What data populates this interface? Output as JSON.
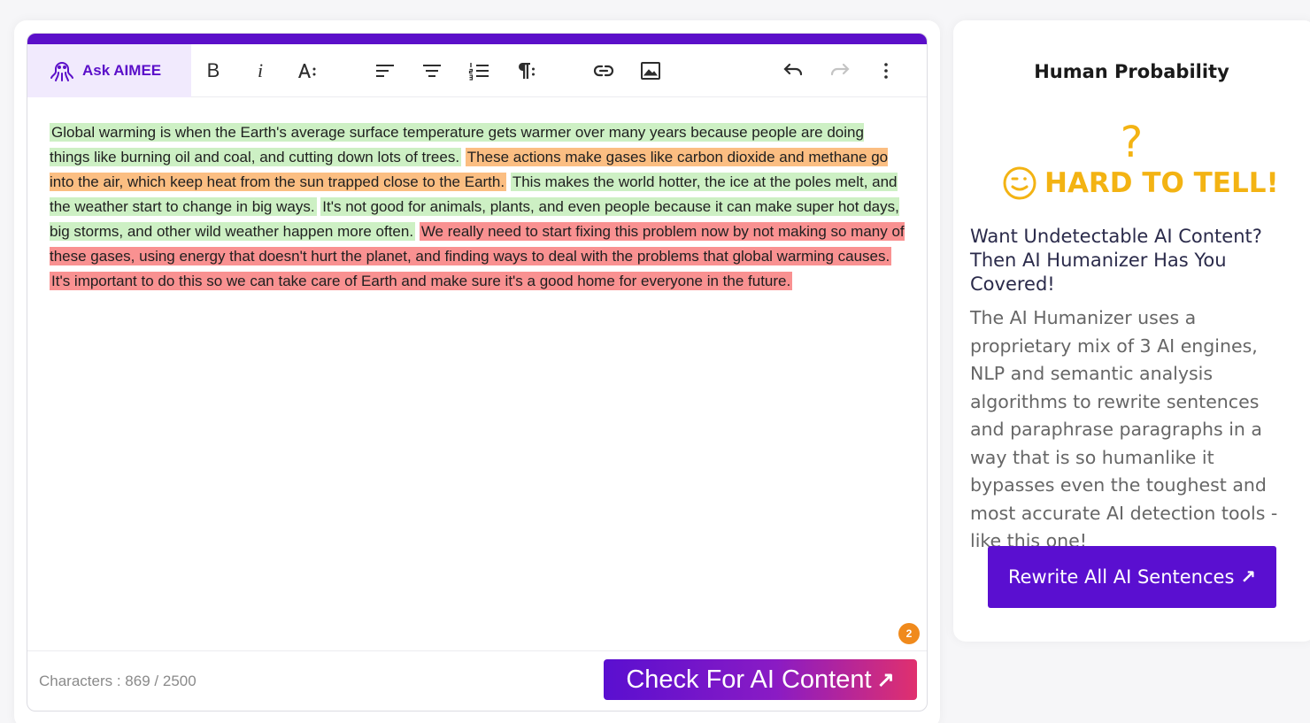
{
  "editor": {
    "ask_label": "Ask AIMEE",
    "toolbar_icons": [
      "bold-icon",
      "italic-icon",
      "font-size-icon",
      "align-left-icon",
      "align-center-icon",
      "numbered-list-icon",
      "paragraph-icon",
      "link-icon",
      "image-icon",
      "undo-icon",
      "redo-icon",
      "more-icon"
    ],
    "sentences": [
      {
        "text": "Global warming is when the Earth's average surface temperature gets warmer over many years because people are doing things like burning oil and coal, and cutting down lots of trees.",
        "status": "green"
      },
      {
        "text": "These actions make gases like carbon dioxide and methane go into the air, which keep heat from the sun trapped close to the Earth.",
        "status": "orange"
      },
      {
        "text": "This makes the world hotter, the ice at the poles melt, and the weather start to change in big ways.",
        "status": "green"
      },
      {
        "text": "It's not good for animals, plants, and even people because it can make super hot days, big storms, and other wild weather happen more often.",
        "status": "green"
      },
      {
        "text": "We really need to start fixing this problem now by not making so many of these gases, using energy that doesn't hurt the planet, and finding ways to deal with the problems that global warming causes.",
        "status": "red"
      },
      {
        "text": "It's important to do this so we can take care of Earth and make sure it's a good home for everyone in the future.",
        "status": "red"
      }
    ],
    "badge_count": "2",
    "characters_label": "Characters : 869",
    "characters_limit": "/ 2500",
    "check_button": "Check For AI Content",
    "colors": {
      "accent": "#5b0fc9",
      "green": "#cdf0c4",
      "orange": "#fbbe82",
      "red": "#f99191"
    }
  },
  "side": {
    "title": "Human Probability",
    "question_mark": "?",
    "verdict": "HARD TO TELL!",
    "verdict_color": "#f3b313",
    "promo_heading": "Want Undetectable AI Content? Then AI Humanizer Has You Covered!",
    "promo_body": "The AI Humanizer uses a proprietary mix of 3 AI engines, NLP and semantic analysis algorithms to rewrite sentences and paraphrase paragraphs in a way that is so humanlike it bypasses even the toughest and most accurate AI detection tools - like this one!",
    "rewrite_button": "Rewrite All AI Sentences"
  }
}
